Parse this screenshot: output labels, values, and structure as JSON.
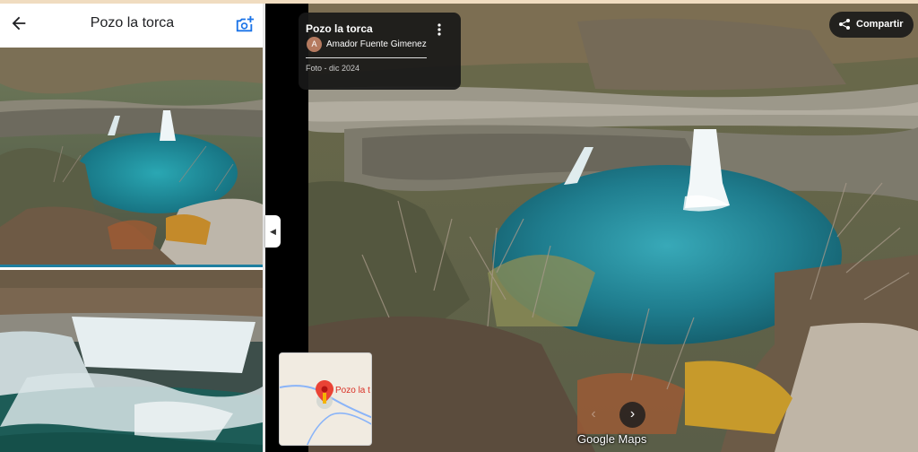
{
  "left_panel": {
    "title": "Pozo la torca",
    "back_icon": "arrow-left-icon",
    "add_photo_icon": "add-photo-icon"
  },
  "photo_info": {
    "title": "Pozo la torca",
    "author_initial": "A",
    "author": "Amador Fuente Gimenez",
    "date": "Foto - dic 2024",
    "menu_icon": "more-vert-icon"
  },
  "share": {
    "label": "Compartir",
    "icon": "share-icon"
  },
  "minimap": {
    "place_label": "Pozo la t",
    "pin_icon": "map-pin-icon"
  },
  "navigation": {
    "prev_icon": "chevron-left-icon",
    "next_icon": "chevron-right-icon"
  },
  "watermark": {
    "text": "Google Maps"
  },
  "colors": {
    "accent_blue": "#1a73e8",
    "pin_red": "#ea4335",
    "card_bg": "#181818"
  }
}
